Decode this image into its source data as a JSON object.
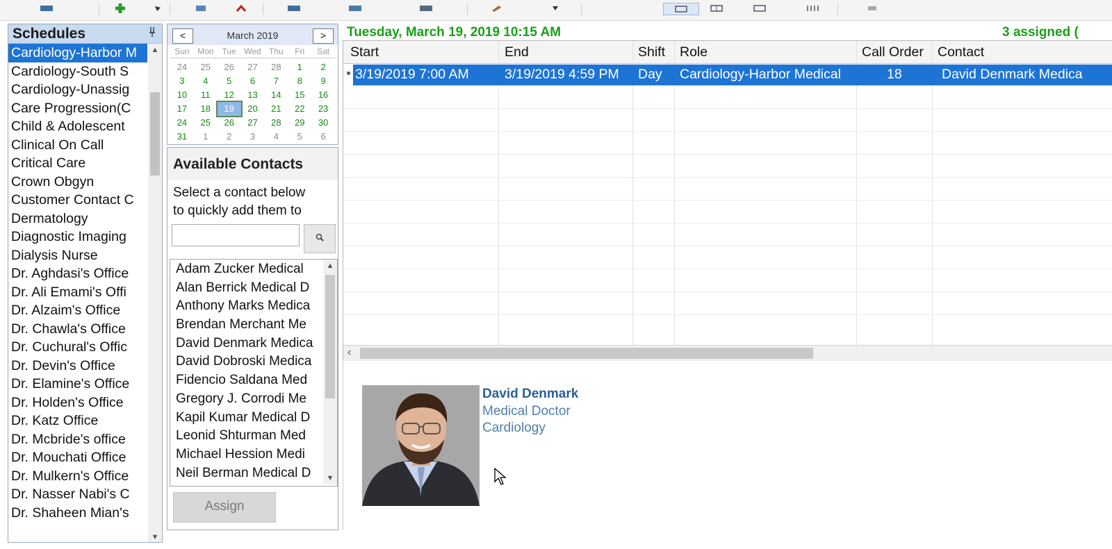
{
  "toolbar": {
    "buttons": [
      "schedule-icon",
      "add-icon",
      "dropdown-icon",
      "copy-icon",
      "delete-icon",
      "print-icon",
      "export-icon",
      "report-icon",
      "edit-icon",
      "more-icon",
      "day-view-icon",
      "week-view-icon",
      "month-view-icon",
      "timeline-view-icon",
      "settings-icon"
    ]
  },
  "schedules": {
    "title": "Schedules",
    "pin": "p",
    "items": [
      "Cardiology-Harbor M",
      "Cardiology-South S",
      "Cardiology-Unassig",
      "Care Progression(C",
      "Child & Adolescent",
      "Clinical On Call",
      "Critical Care",
      "Crown Obgyn",
      "Customer Contact C",
      "Dermatology",
      "Diagnostic Imaging",
      "Dialysis Nurse",
      "Dr. Aghdasi's Office",
      "Dr. Ali Emami's Offi",
      "Dr. Alzaim's Office",
      "Dr. Chawla's Office",
      "Dr. Cuchural's Offic",
      "Dr. Devin's Office",
      "Dr. Elamine's Office",
      "Dr. Holden's Office",
      "Dr. Katz Office",
      "Dr. Mcbride's office",
      "Dr. Mouchati Office",
      "Dr. Mulkern's Office",
      "Dr. Nasser Nabi's C",
      "Dr. Shaheen Mian's"
    ],
    "selected_index": 0
  },
  "calendar": {
    "month": "March 2019",
    "prev": "<",
    "next": ">",
    "dow": [
      "Sun",
      "Mon",
      "Tue",
      "Wed",
      "Thu",
      "Fri",
      "Sat"
    ],
    "days": [
      [
        "24",
        "other"
      ],
      [
        "25",
        "other"
      ],
      [
        "26",
        "other"
      ],
      [
        "27",
        "other"
      ],
      [
        "28",
        "other"
      ],
      [
        "1",
        ""
      ],
      [
        "2",
        ""
      ],
      [
        "3",
        ""
      ],
      [
        "4",
        ""
      ],
      [
        "5",
        ""
      ],
      [
        "6",
        ""
      ],
      [
        "7",
        ""
      ],
      [
        "8",
        ""
      ],
      [
        "9",
        ""
      ],
      [
        "10",
        ""
      ],
      [
        "11",
        ""
      ],
      [
        "12",
        ""
      ],
      [
        "13",
        ""
      ],
      [
        "14",
        ""
      ],
      [
        "15",
        ""
      ],
      [
        "16",
        ""
      ],
      [
        "17",
        ""
      ],
      [
        "18",
        ""
      ],
      [
        "19",
        "sel"
      ],
      [
        "20",
        ""
      ],
      [
        "21",
        ""
      ],
      [
        "22",
        ""
      ],
      [
        "23",
        ""
      ],
      [
        "24",
        ""
      ],
      [
        "25",
        ""
      ],
      [
        "26",
        ""
      ],
      [
        "27",
        ""
      ],
      [
        "28",
        ""
      ],
      [
        "29",
        ""
      ],
      [
        "30",
        ""
      ],
      [
        "31",
        ""
      ],
      [
        "1",
        "other"
      ],
      [
        "2",
        "other"
      ],
      [
        "3",
        "other"
      ],
      [
        "4",
        "other"
      ],
      [
        "5",
        "other"
      ],
      [
        "6",
        "other"
      ]
    ]
  },
  "contacts": {
    "title": "Available Contacts",
    "help_line1": "Select a contact below",
    "help_line2": "to quickly add them to",
    "search_value": "",
    "search_icon": "search-icon",
    "items": [
      "Adam Zucker Medical",
      "Alan Berrick Medical D",
      "Anthony Marks Medica",
      "Brendan Merchant Me",
      "David Denmark Medica",
      "David Dobroski Medica",
      "Fidencio Saldana Med",
      "Gregory J. Corrodi Me",
      "Kapil Kumar Medical D",
      "Leonid Shturman Med",
      "Michael Hession Medi",
      "Neil Berman Medical D"
    ],
    "assign_label": "Assign"
  },
  "main": {
    "date_title": "Tuesday, March 19, 2019 10:15 AM",
    "assigned": "3 assigned (",
    "columns": [
      "Start",
      "End",
      "Shift",
      "Role",
      "Call Order",
      "Contact"
    ],
    "rows": [
      {
        "start": "3/19/2019 7:00 AM",
        "end": "3/19/2019 4:59 PM",
        "shift": "Day",
        "role": "Cardiology-Harbor Medical",
        "call_order": "18",
        "contact": "David Denmark Medica"
      }
    ]
  },
  "detail": {
    "name": "David Denmark",
    "title": "Medical Doctor",
    "department": "Cardiology"
  },
  "colors": {
    "accent_blue": "#1e74d4",
    "green_text": "#18a018",
    "header_blue": "#c8daf0"
  }
}
